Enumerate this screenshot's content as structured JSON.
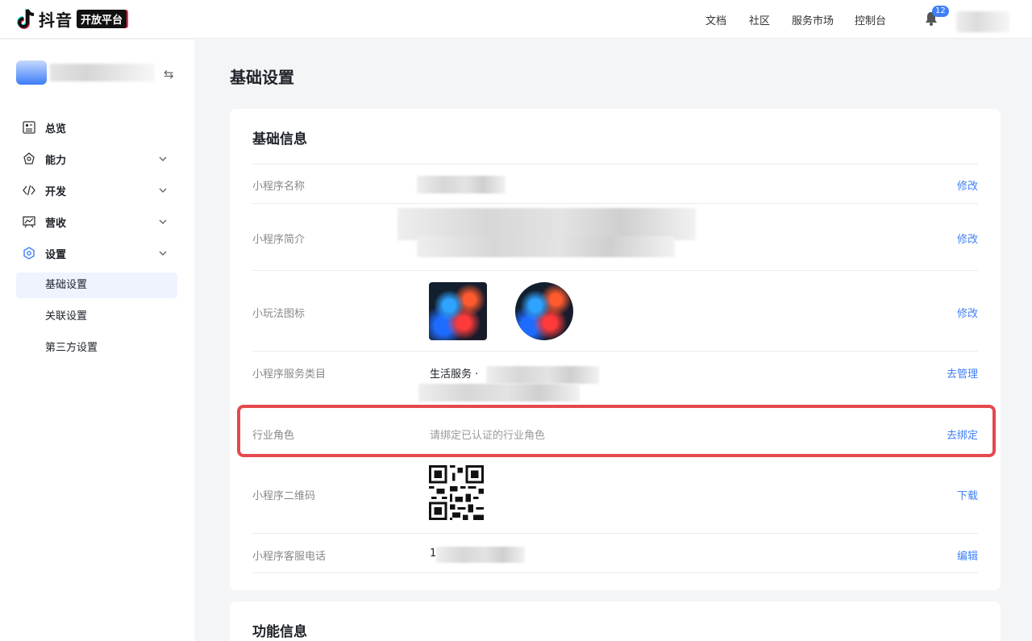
{
  "header": {
    "brand": "抖音",
    "badge": "开放平台",
    "nav": [
      "文档",
      "社区",
      "服务市场",
      "控制台"
    ],
    "notification_count": "12"
  },
  "sidebar": {
    "switch_icon": "swap-icon",
    "items": [
      {
        "label": "总览",
        "icon": "dashboard-icon"
      },
      {
        "label": "能力",
        "icon": "capability-icon"
      },
      {
        "label": "开发",
        "icon": "code-icon"
      },
      {
        "label": "营收",
        "icon": "revenue-chart-icon"
      },
      {
        "label": "设置",
        "icon": "settings-icon"
      }
    ],
    "sub_items": [
      "基础设置",
      "关联设置",
      "第三方设置"
    ]
  },
  "main": {
    "page_title": "基础设置",
    "card_title": "基础信息",
    "rows": {
      "name": {
        "label": "小程序名称",
        "action": "修改"
      },
      "intro": {
        "label": "小程序简介",
        "action": "修改"
      },
      "icon": {
        "label": "小玩法图标",
        "action": "修改"
      },
      "category": {
        "label": "小程序服务类目",
        "value": "生活服务 ·",
        "action": "去管理"
      },
      "role": {
        "label": "行业角色",
        "value": "请绑定已认证的行业角色",
        "action": "去绑定"
      },
      "qrcode": {
        "label": "小程序二维码",
        "action": "下载"
      },
      "phone": {
        "label": "小程序客服电话",
        "value": "1",
        "action": "编辑"
      }
    },
    "card2_title": "功能信息"
  },
  "colors": {
    "accent": "#3e7ff7",
    "highlight": "#e5484d"
  }
}
